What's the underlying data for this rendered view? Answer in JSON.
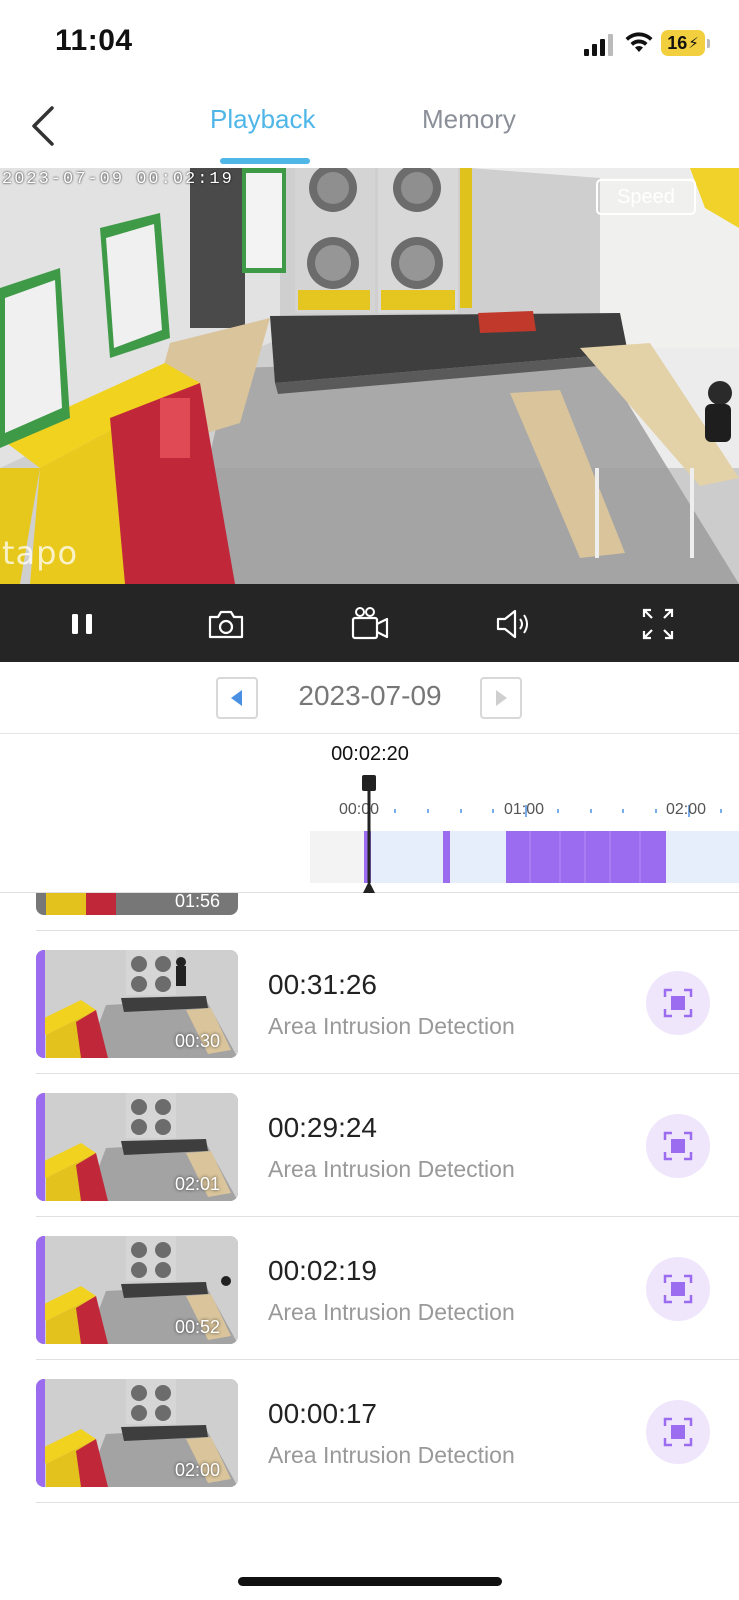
{
  "status_bar": {
    "time": "11:04",
    "battery": "16"
  },
  "nav": {
    "back_icon": "chevron-left-icon",
    "tabs": [
      {
        "label": "Playback",
        "active": true
      },
      {
        "label": "Memory",
        "active": false
      }
    ],
    "active_color": "#4fb6e8"
  },
  "video": {
    "timestamp": "2023-07-09  00:02:19",
    "speed_label": "Speed",
    "watermark": "tapo"
  },
  "controls": [
    {
      "name": "pause",
      "icon": "pause-icon"
    },
    {
      "name": "snapshot",
      "icon": "camera-icon"
    },
    {
      "name": "record",
      "icon": "video-camera-icon"
    },
    {
      "name": "volume",
      "icon": "speaker-icon"
    },
    {
      "name": "fullscreen",
      "icon": "fullscreen-icon"
    }
  ],
  "date_bar": {
    "date": "2023-07-09",
    "prev_icon": "triangle-left-icon",
    "next_icon": "triangle-right-icon"
  },
  "timeline": {
    "current_time": "00:02:20",
    "labels": [
      "00:00",
      "01:00",
      "02:00"
    ],
    "recording_color": "#9b6cf0"
  },
  "events": {
    "partial_duration": "01:56",
    "items": [
      {
        "time": "00:31:26",
        "type": "Area Intrusion Detection",
        "duration": "00:30",
        "icon": "area-intrusion-icon"
      },
      {
        "time": "00:29:24",
        "type": "Area Intrusion Detection",
        "duration": "02:01",
        "icon": "area-intrusion-icon"
      },
      {
        "time": "00:02:19",
        "type": "Area Intrusion Detection",
        "duration": "00:52",
        "icon": "area-intrusion-icon"
      },
      {
        "time": "00:00:17",
        "type": "Area Intrusion Detection",
        "duration": "02:00",
        "icon": "area-intrusion-icon"
      }
    ]
  }
}
